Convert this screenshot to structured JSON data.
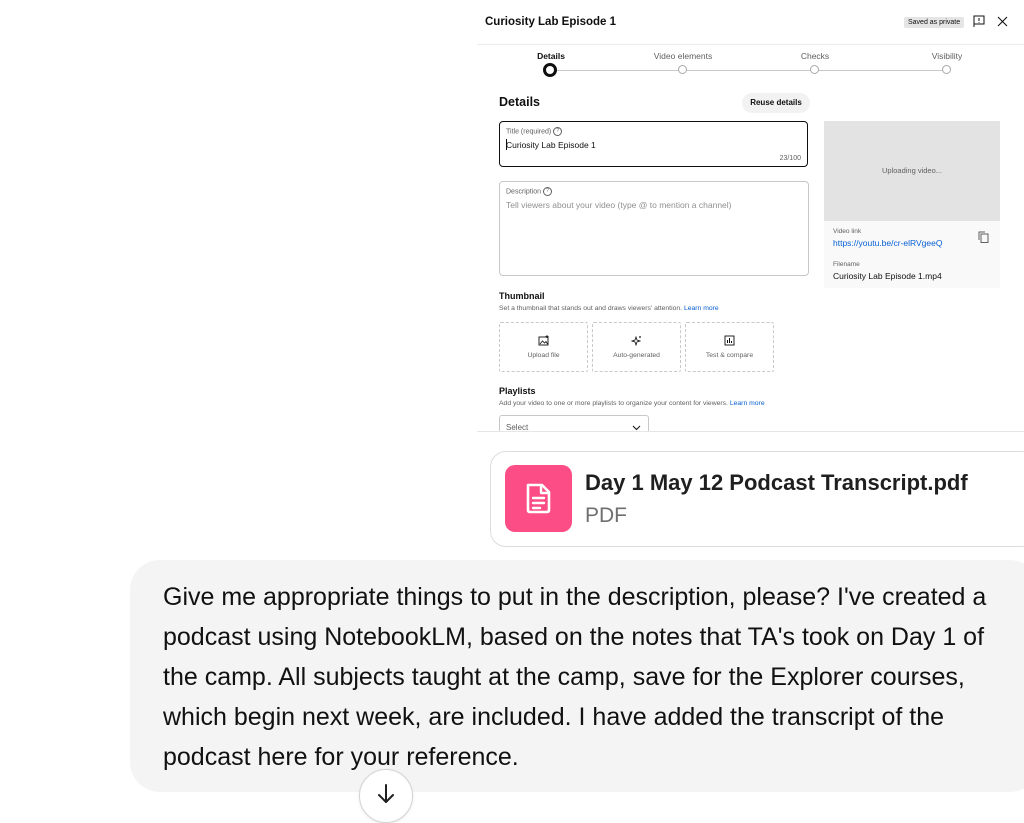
{
  "dialog": {
    "title": "Curiosity Lab Episode 1",
    "saved_badge": "Saved as private",
    "steps": [
      {
        "label": "Details",
        "active": true
      },
      {
        "label": "Video elements",
        "active": false
      },
      {
        "label": "Checks",
        "active": false
      },
      {
        "label": "Visibility",
        "active": false
      }
    ],
    "section_title": "Details",
    "reuse_button": "Reuse details",
    "title_field": {
      "label": "Title (required)",
      "value": "Curiosity Lab Episode 1",
      "counter": "23/100"
    },
    "description_field": {
      "label": "Description",
      "placeholder": "Tell viewers about your video (type @ to mention a channel)"
    },
    "preview": {
      "status": "Uploading video...",
      "video_link_label": "Video link",
      "video_link": "https://youtu.be/cr-elRVgeeQ",
      "filename_label": "Filename",
      "filename": "Curiosity Lab Episode 1.mp4"
    },
    "thumbnail": {
      "title": "Thumbnail",
      "subtitle": "Set a thumbnail that stands out and draws viewers' attention.",
      "learn_more": "Learn more",
      "options": [
        "Upload file",
        "Auto-generated",
        "Test & compare"
      ]
    },
    "playlists": {
      "title": "Playlists",
      "subtitle": "Add your video to one or more playlists to organize your content for viewers.",
      "learn_more": "Learn more",
      "select_value": "Select"
    }
  },
  "attachment": {
    "name": "Day 1 May 12 Podcast Transcript.pdf",
    "type": "PDF",
    "icon": "document-icon",
    "color": "#fc4d86"
  },
  "message": {
    "text": "Give me appropriate things to put in the description, please? I've created a podcast using NotebookLM, based on the notes that TA's took on Day 1 of the camp. All subjects taught at the camp, save for the Explorer courses, which begin next week, are included. I have added the transcript of the podcast here for your reference."
  },
  "colors": {
    "link": "#065fd4",
    "bubble": "#f4f4f4",
    "pdf_tile": "#fc4d86"
  }
}
